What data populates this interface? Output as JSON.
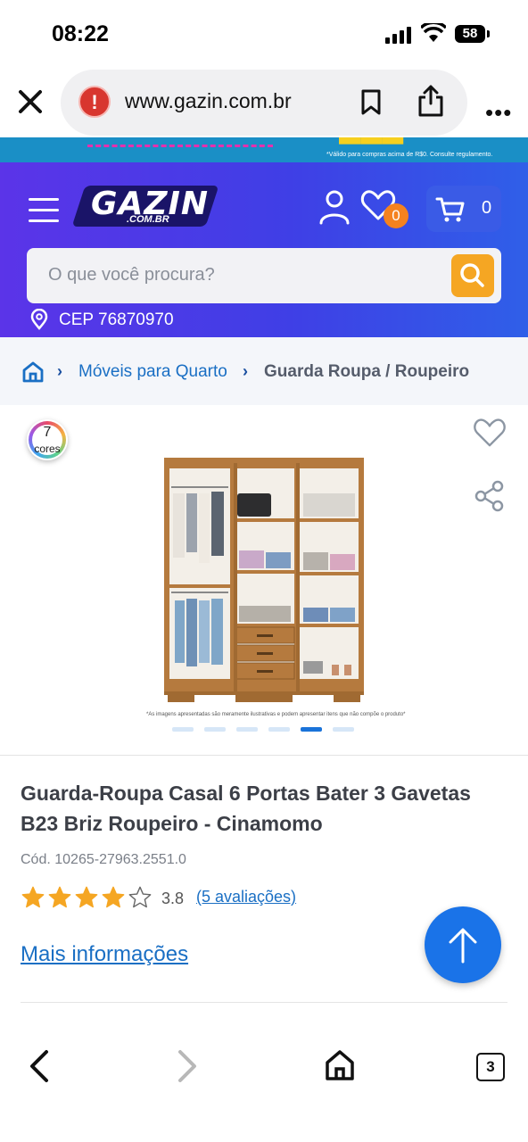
{
  "status_bar": {
    "time": "08:22",
    "battery": "58"
  },
  "browser": {
    "url": "www.gazin.com.br",
    "tab_count": "3"
  },
  "promo": {
    "footnote": "*Válido para compras acima de R$0. Consulte regulamento."
  },
  "header": {
    "logo_text": "GAZIN",
    "logo_sub": ".COM.BR",
    "wishlist_count": "0",
    "cart_count": "0",
    "search_placeholder": "O que você procura?",
    "cep_label": "CEP 76870970"
  },
  "breadcrumb": {
    "items": [
      "Móveis para Quarto",
      "Guarda Roupa / Roupeiro"
    ]
  },
  "product": {
    "colors_count": "7",
    "colors_label": "cores",
    "disclaimer": "*As imagens apresentadas são meramente ilustrativas e podem apresentar itens que não compõe o produto*",
    "image_count": 6,
    "active_image": 5,
    "title": "Guarda-Roupa Casal 6 Portas Bater 3 Gavetas B23 Briz Roupeiro - Cinamomo",
    "code": "Cód. 10265-27963.2551.0",
    "rating": "3.8",
    "rating_value": 3.8,
    "rating_max": 5,
    "reviews": "(5 avaliações)",
    "more_info": "Mais informações"
  },
  "colors": {
    "brand_purple": "#5b34e8",
    "brand_blue": "#2f5fe8",
    "accent_orange": "#f5a623",
    "link_blue": "#1a6fc4",
    "star": "#f5a623"
  },
  "icons": [
    "close-icon",
    "warning-icon",
    "bookmark-icon",
    "share-icon",
    "more-icon",
    "menu-icon",
    "user-icon",
    "heart-icon",
    "cart-icon",
    "search-icon",
    "location-pin-icon",
    "home-icon",
    "chevron-right-icon",
    "favorite-icon",
    "share-network-icon",
    "arrow-up-icon",
    "back-icon",
    "forward-icon",
    "tabs-icon"
  ]
}
